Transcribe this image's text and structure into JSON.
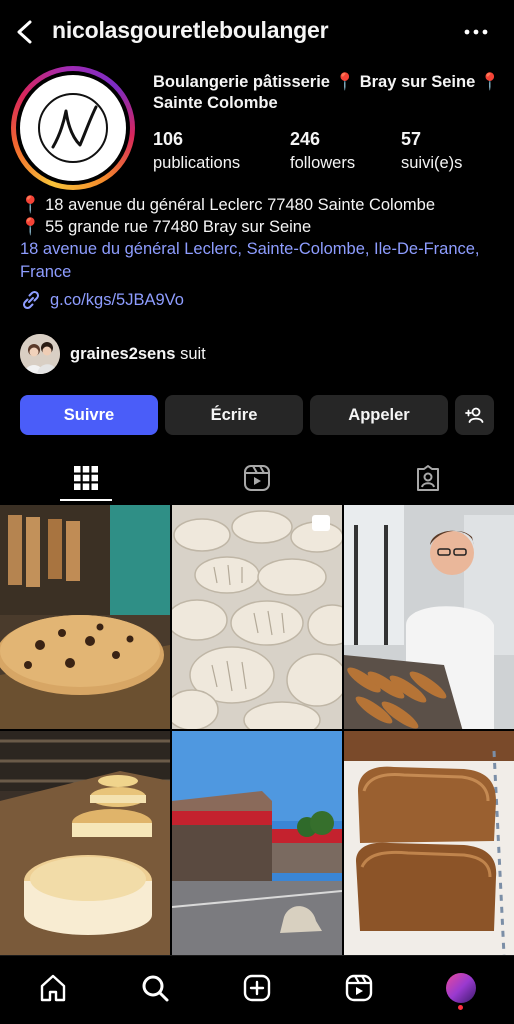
{
  "header": {
    "username": "nicolasgouretleboulanger",
    "back_icon": "chevron-left-icon",
    "more_icon": "ellipsis-icon"
  },
  "profile": {
    "bio_title": "Boulangerie pâtisserie 📍 Bray sur Seine 📍 Sainte Colombe",
    "stats": [
      {
        "value": "106",
        "label": "publications"
      },
      {
        "value": "246",
        "label": "followers"
      },
      {
        "value": "57",
        "label": "suivi(e)s"
      }
    ],
    "address_line_1": "📍 18 avenue du général Leclerc 77480 Sainte Colombe",
    "address_line_2": "📍 55 grande rue 77480 Bray sur Seine",
    "map_link": "18 avenue du général Leclerc, Sainte-Colombe, Ile-De-France, France",
    "website": "g.co/kgs/5JBA9Vo"
  },
  "followed_by": {
    "name": "graines2sens",
    "suffix": " suit"
  },
  "actions": {
    "follow": "Suivre",
    "message": "Écrire",
    "call": "Appeler",
    "suggest_icon": "add-person-icon"
  },
  "tabs": [
    {
      "name": "grid",
      "icon": "grid-icon",
      "active": true
    },
    {
      "name": "reels",
      "icon": "reels-icon",
      "active": false
    },
    {
      "name": "tagged",
      "icon": "tagged-icon",
      "active": false
    }
  ],
  "posts": [
    {
      "subject": "cookie",
      "multi": false
    },
    {
      "subject": "croissants",
      "multi": true
    },
    {
      "subject": "baker-with-baguettes",
      "multi": false
    },
    {
      "subject": "flans",
      "multi": false
    },
    {
      "subject": "storefront",
      "multi": false
    },
    {
      "subject": "bread-loaves",
      "multi": false
    }
  ],
  "nav": [
    {
      "name": "home",
      "icon": "home-icon"
    },
    {
      "name": "search",
      "icon": "search-icon"
    },
    {
      "name": "create",
      "icon": "plus-square-icon"
    },
    {
      "name": "reels",
      "icon": "reels-icon"
    },
    {
      "name": "profile",
      "icon": "avatar-icon"
    }
  ],
  "colors": {
    "accent": "#4a5df9",
    "link": "#8e9dff",
    "button": "#262626",
    "notification": "#ff3040"
  }
}
